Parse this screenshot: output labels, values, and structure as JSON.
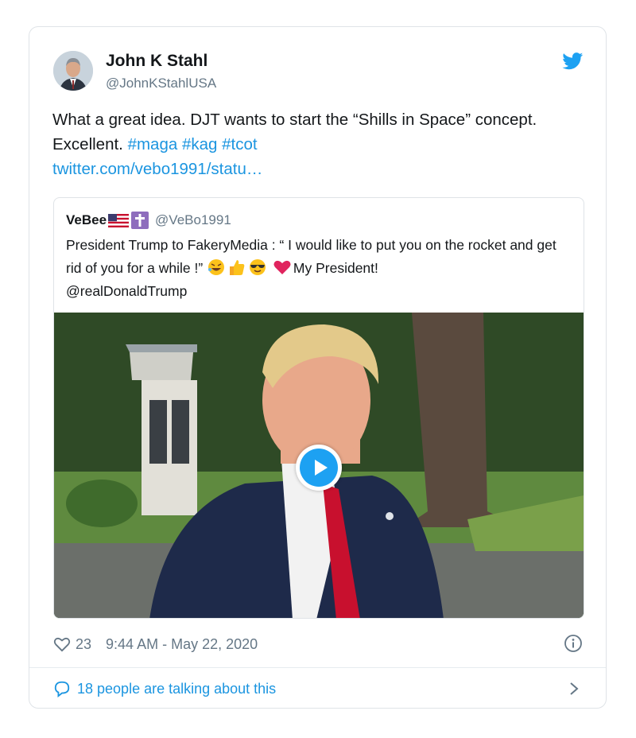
{
  "tweet": {
    "author_name": "John K Stahl",
    "author_handle": "@JohnKStahlUSA",
    "text_part1": "What a great idea. DJT wants to start the “Shills in Space” concept. Excellent. ",
    "hashtags": [
      "#maga",
      "#kag",
      "#tcot"
    ],
    "link": "twitter.com/vebo1991/statu…",
    "likes": "23",
    "timestamp": "9:44 AM - May 22, 2020",
    "conversation": "18 people are talking about this"
  },
  "quoted": {
    "author_name": "VeBee",
    "author_handle": "@VeBo1991",
    "text_part1": "President Trump to FakeryMedia : “ I would like to put you on the rocket and get rid of you for a while !” ",
    "text_part2": "My President!",
    "mention": "@realDonaldTrump",
    "emojis": [
      "rofl-emoji",
      "thumbs-up-emoji",
      "sunglasses-emoji",
      "red-heart-emoji"
    ]
  },
  "icons": [
    "twitter-bird-icon",
    "heart-icon",
    "info-icon",
    "speech-bubble-icon",
    "chevron-right-icon",
    "play-icon"
  ],
  "colors": {
    "link": "#1b95e0",
    "muted": "#657786",
    "play": "#1da1f2",
    "border": "#dfe3e7"
  }
}
